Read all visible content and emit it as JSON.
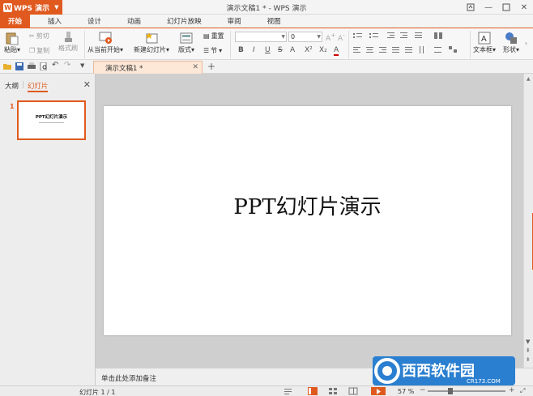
{
  "titlebar": {
    "app_name": "WPS 演示",
    "doc_title": "演示文稿1 * - WPS 演示"
  },
  "tabs": [
    {
      "label": "开始",
      "active": true
    },
    {
      "label": "插入"
    },
    {
      "label": "设计"
    },
    {
      "label": "动画"
    },
    {
      "label": "幻灯片放映"
    },
    {
      "label": "审阅"
    },
    {
      "label": "视图"
    }
  ],
  "ribbon": {
    "paste": "粘贴",
    "cut": "剪切",
    "copy": "复制",
    "format_painter": "格式刷",
    "from_current": "从当前开始",
    "new_slide": "新建幻灯片",
    "layout": "版式",
    "reset": "重置",
    "section": "节",
    "font_name": "",
    "font_size": "0",
    "bold": "B",
    "italic": "I",
    "underline": "U",
    "strike": "S",
    "shadow": "A",
    "superscript": "X²",
    "subscript": "X₂",
    "textbox": "文本框",
    "shape": "形状"
  },
  "doc_tab": {
    "label": "演示文稿1 *"
  },
  "left_panel": {
    "tab_outline": "大纲",
    "tab_slides": "幻灯片",
    "thumb_number": "1",
    "thumb_title": "PPT幻灯片演示"
  },
  "slide": {
    "title": "PPT幻灯片演示"
  },
  "notes": {
    "placeholder": "单击此处添加备注"
  },
  "status": {
    "slide_info": "幻灯片 1 / 1",
    "zoom": "57 %",
    "zoom_level": 0.57
  },
  "watermark": {
    "brand": "西西软件园",
    "url": "CR173.COM"
  },
  "colors": {
    "accent": "#e05a1f"
  }
}
